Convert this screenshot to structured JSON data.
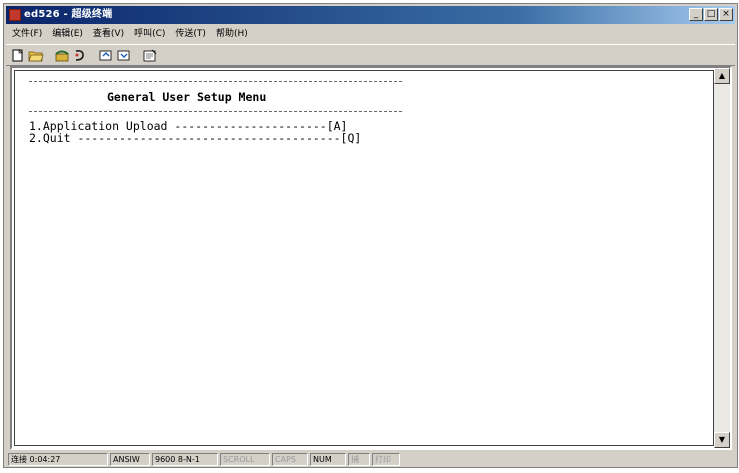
{
  "window": {
    "title": "ed526 - 超级终端",
    "buttons": {
      "minimize": "_",
      "maximize": "□",
      "close": "×"
    }
  },
  "menubar": {
    "items": [
      {
        "label": "文件(F)"
      },
      {
        "label": "编辑(E)"
      },
      {
        "label": "查看(V)"
      },
      {
        "label": "呼叫(C)"
      },
      {
        "label": "传送(T)"
      },
      {
        "label": "帮助(H)"
      }
    ]
  },
  "toolbar": {
    "buttons": [
      {
        "icon": "new-document-icon"
      },
      {
        "icon": "open-folder-icon"
      },
      {
        "icon": "phone-connect-icon"
      },
      {
        "icon": "disconnect-icon"
      },
      {
        "icon": "send-file-icon"
      },
      {
        "icon": "receive-file-icon"
      },
      {
        "icon": "properties-icon"
      }
    ]
  },
  "terminal": {
    "title": "General User Setup Menu",
    "menu_items": [
      {
        "label": "1.Application Upload ----------------------[A]"
      },
      {
        "label": "2.Quit --------------------------------------[Q]"
      }
    ]
  },
  "scrollbar": {
    "up": "▲",
    "down": "▼"
  },
  "statusbar": {
    "connected_time": "连接 0:04:27",
    "emulation": "ANSIW",
    "port_settings": "9600 8-N-1",
    "scroll": "SCROLL",
    "caps": "CAPS",
    "num": "NUM",
    "capture": "捕",
    "print_echo": "打印"
  }
}
